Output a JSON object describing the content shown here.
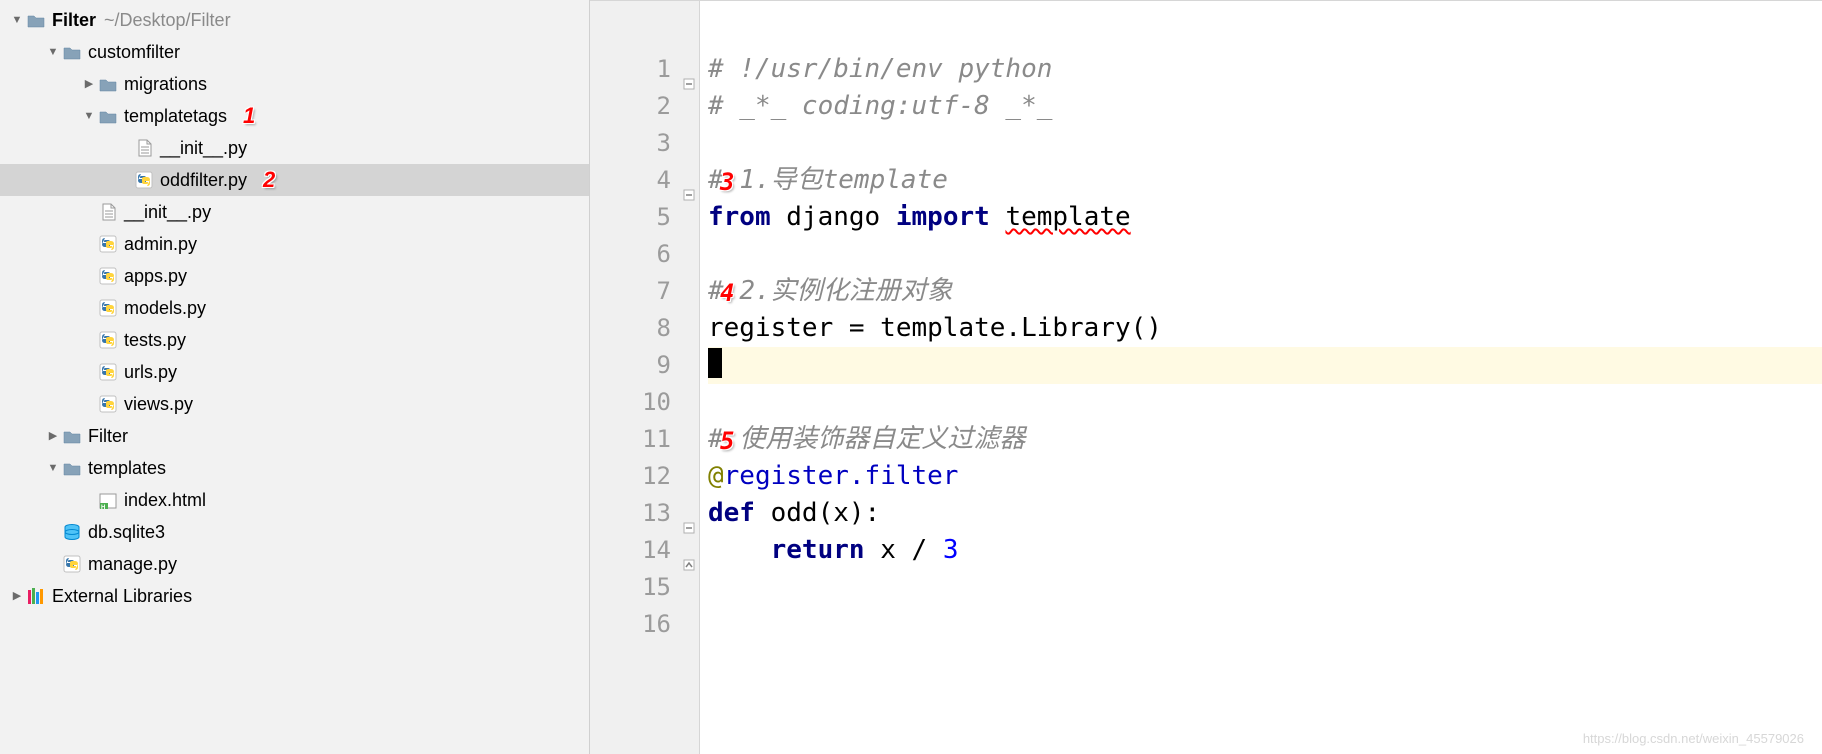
{
  "project": {
    "root_name": "Filter",
    "root_path": "~/Desktop/Filter",
    "tree": [
      {
        "indent": 0,
        "arrow": "down",
        "icon": "folder",
        "label": "Filter",
        "bold": true,
        "path": "~/Desktop/Filter"
      },
      {
        "indent": 1,
        "arrow": "down",
        "icon": "folder",
        "label": "customfilter"
      },
      {
        "indent": 2,
        "arrow": "right",
        "icon": "folder",
        "label": "migrations"
      },
      {
        "indent": 2,
        "arrow": "down",
        "icon": "folder",
        "label": "templatetags",
        "annot": "1"
      },
      {
        "indent": 3,
        "arrow": "",
        "icon": "file",
        "label": "__init__.py"
      },
      {
        "indent": 3,
        "arrow": "",
        "icon": "py",
        "label": "oddfilter.py",
        "annot": "2",
        "selected": true
      },
      {
        "indent": 2,
        "arrow": "",
        "icon": "file",
        "label": "__init__.py"
      },
      {
        "indent": 2,
        "arrow": "",
        "icon": "py",
        "label": "admin.py"
      },
      {
        "indent": 2,
        "arrow": "",
        "icon": "py",
        "label": "apps.py"
      },
      {
        "indent": 2,
        "arrow": "",
        "icon": "py",
        "label": "models.py"
      },
      {
        "indent": 2,
        "arrow": "",
        "icon": "py",
        "label": "tests.py"
      },
      {
        "indent": 2,
        "arrow": "",
        "icon": "py",
        "label": "urls.py"
      },
      {
        "indent": 2,
        "arrow": "",
        "icon": "py",
        "label": "views.py"
      },
      {
        "indent": 1,
        "arrow": "right",
        "icon": "folder",
        "label": "Filter"
      },
      {
        "indent": 1,
        "arrow": "down",
        "icon": "folder",
        "label": "templates"
      },
      {
        "indent": 2,
        "arrow": "",
        "icon": "html",
        "label": "index.html"
      },
      {
        "indent": 1,
        "arrow": "",
        "icon": "db",
        "label": "db.sqlite3"
      },
      {
        "indent": 1,
        "arrow": "",
        "icon": "py",
        "label": "manage.py"
      },
      {
        "indent": 0,
        "arrow": "right",
        "icon": "lib",
        "label": "External Libraries"
      }
    ]
  },
  "editor": {
    "lines": [
      {
        "n": 1,
        "fold": "minus",
        "segs": [
          {
            "t": "# !/usr/bin/env python",
            "cls": "c-comment"
          }
        ]
      },
      {
        "n": 2,
        "segs": [
          {
            "t": "# _*_ coding:utf-8 _*_",
            "cls": "c-comment"
          }
        ]
      },
      {
        "n": 3,
        "segs": []
      },
      {
        "n": 4,
        "fold": "minus",
        "annot": "3",
        "segs": [
          {
            "t": "# ",
            "cls": "c-comment"
          },
          {
            "t": "1.导包template",
            "cls": "c-comment"
          }
        ]
      },
      {
        "n": 5,
        "segs": [
          {
            "t": "from ",
            "cls": "c-kw"
          },
          {
            "t": "django ",
            "cls": "c-plain"
          },
          {
            "t": "import ",
            "cls": "c-kw"
          },
          {
            "t": "template",
            "cls": "c-plain err-underline"
          }
        ]
      },
      {
        "n": 6,
        "segs": []
      },
      {
        "n": 7,
        "annot": "4",
        "segs": [
          {
            "t": "# ",
            "cls": "c-comment"
          },
          {
            "t": "2.实例化注册对象",
            "cls": "c-comment"
          }
        ]
      },
      {
        "n": 8,
        "segs": [
          {
            "t": "register = template.Library()",
            "cls": "c-plain"
          }
        ]
      },
      {
        "n": 9,
        "current": true,
        "cursor": true,
        "segs": []
      },
      {
        "n": 10,
        "segs": []
      },
      {
        "n": 11,
        "annot": "5",
        "segs": [
          {
            "t": "# ",
            "cls": "c-comment"
          },
          {
            "t": "使用装饰器自定义过滤器",
            "cls": "c-comment"
          }
        ]
      },
      {
        "n": 12,
        "segs": [
          {
            "t": "@",
            "cls": "c-decor"
          },
          {
            "t": "register.filter",
            "cls": "c-dec-name"
          }
        ]
      },
      {
        "n": 13,
        "fold": "minus",
        "segs": [
          {
            "t": "def ",
            "cls": "c-kw"
          },
          {
            "t": "odd(x):",
            "cls": "c-plain"
          }
        ]
      },
      {
        "n": 14,
        "fold": "up",
        "segs": [
          {
            "t": "    ",
            "cls": "c-plain"
          },
          {
            "t": "return ",
            "cls": "c-kw"
          },
          {
            "t": "x / ",
            "cls": "c-plain"
          },
          {
            "t": "3",
            "cls": "c-num"
          }
        ]
      },
      {
        "n": 15,
        "segs": []
      },
      {
        "n": 16,
        "segs": []
      }
    ]
  },
  "watermark": "https://blog.csdn.net/weixin_45579026"
}
